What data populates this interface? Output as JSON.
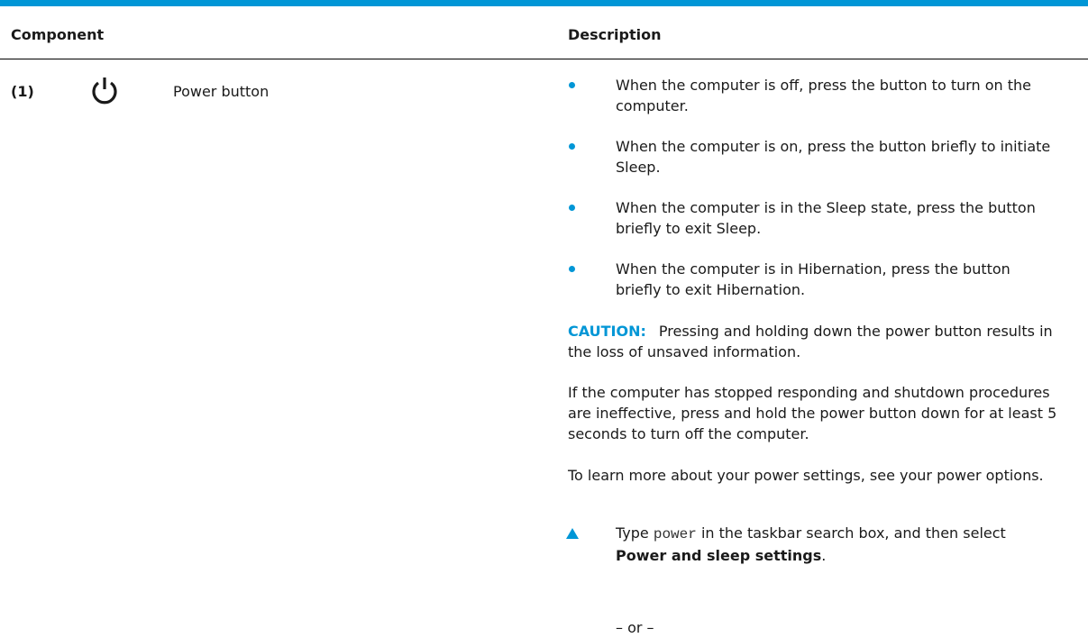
{
  "header": {
    "component": "Component",
    "description": "Description"
  },
  "row": {
    "number": "(1)",
    "icon": "power-icon",
    "name": "Power button"
  },
  "bullets": [
    "When the computer is off, press the button to turn on the computer.",
    "When the computer is on, press the button briefly to initiate Sleep.",
    "When the computer is in the Sleep state, press the button briefly to exit Sleep.",
    "When the computer is in Hibernation, press the button briefly to exit Hibernation."
  ],
  "caution": {
    "label": "CAUTION:",
    "text": "Pressing and holding down the power button results in the loss of unsaved information."
  },
  "paragraphs": [
    "If the computer has stopped responding and shutdown procedures are ineffective, press and hold the power button down for at least 5 seconds to turn off the computer.",
    "To learn more about your power settings, see your power options."
  ],
  "step": {
    "pre": "Type ",
    "code": "power",
    "mid": " in the taskbar search box, and then select ",
    "bold": "Power and sleep settings",
    "post": "."
  },
  "or_text": "– or –",
  "colors": {
    "accent": "#0096d6"
  }
}
